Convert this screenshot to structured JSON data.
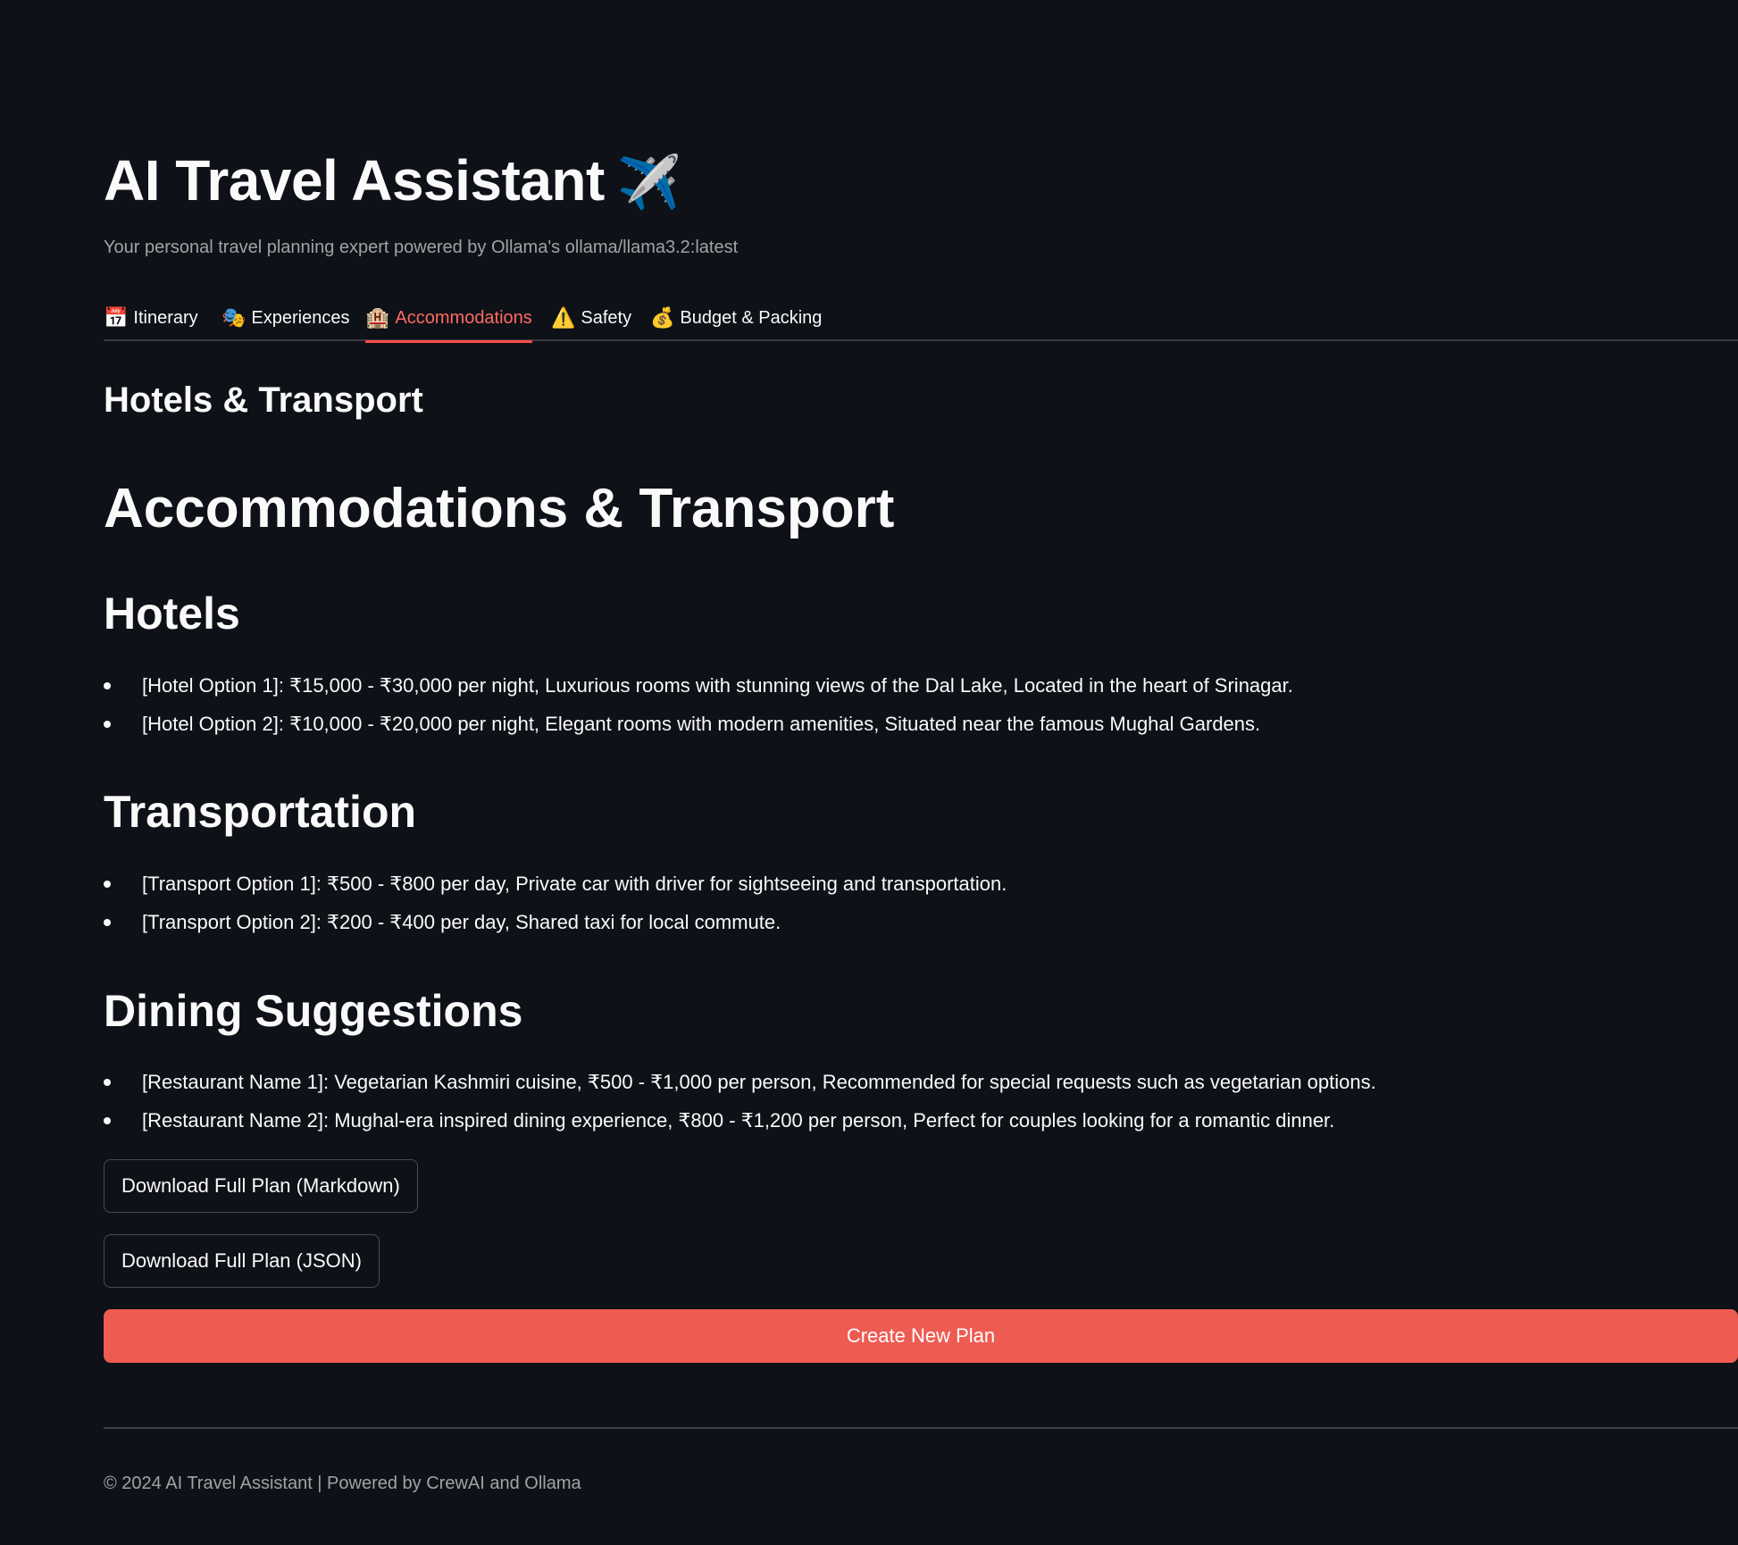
{
  "header": {
    "title": "AI Travel Assistant",
    "title_icon": "✈️",
    "subtitle": "Your personal travel planning expert powered by Ollama's ollama/llama3.2:latest"
  },
  "tabs": [
    {
      "icon": "📅",
      "label": "Itinerary",
      "active": false
    },
    {
      "icon": "🎭",
      "label": "Experiences",
      "active": false
    },
    {
      "icon": "🏨",
      "label": "Accommodations",
      "active": true
    },
    {
      "icon": "⚠️",
      "label": "Safety",
      "active": false
    },
    {
      "icon": "💰",
      "label": "Budget & Packing",
      "active": false
    }
  ],
  "content": {
    "tab_heading": "Hotels & Transport",
    "main_heading": "Accommodations & Transport",
    "sections": [
      {
        "heading": "Hotels",
        "items": [
          "[Hotel Option 1]: ₹15,000 - ₹30,000 per night, Luxurious rooms with stunning views of the Dal Lake, Located in the heart of Srinagar.",
          "[Hotel Option 2]: ₹10,000 - ₹20,000 per night, Elegant rooms with modern amenities, Situated near the famous Mughal Gardens."
        ]
      },
      {
        "heading": "Transportation",
        "items": [
          "[Transport Option 1]: ₹500 - ₹800 per day, Private car with driver for sightseeing and transportation.",
          "[Transport Option 2]: ₹200 - ₹400 per day, Shared taxi for local commute."
        ]
      },
      {
        "heading": "Dining Suggestions",
        "items": [
          "[Restaurant Name 1]: Vegetarian Kashmiri cuisine, ₹500 - ₹1,000 per person, Recommended for special requests such as vegetarian options.",
          "[Restaurant Name 2]: Mughal-era inspired dining experience, ₹800 - ₹1,200 per person, Perfect for couples looking for a romantic dinner."
        ]
      }
    ]
  },
  "actions": {
    "download_markdown": "Download Full Plan (Markdown)",
    "download_json": "Download Full Plan (JSON)",
    "create_new": "Create New Plan"
  },
  "footer": {
    "text": "© 2024 AI Travel Assistant | Powered by CrewAI and Ollama"
  },
  "colors": {
    "background": "#0e1117",
    "accent": "#ff4b4b",
    "primary_button": "#ee5b52"
  }
}
